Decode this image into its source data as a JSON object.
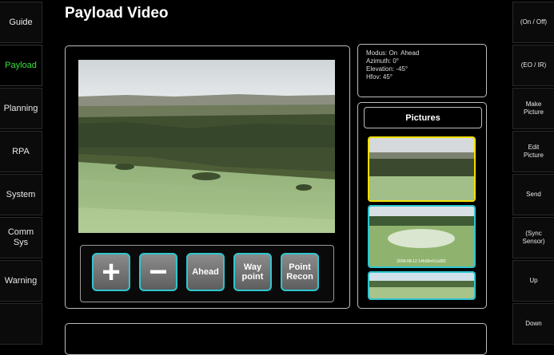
{
  "page": {
    "title": "Payload Video"
  },
  "left_nav": [
    {
      "label": "Guide",
      "active": false
    },
    {
      "label": "Payload",
      "active": true
    },
    {
      "label": "Planning",
      "active": false
    },
    {
      "label": "RPA",
      "active": false
    },
    {
      "label": "System",
      "active": false
    },
    {
      "label": "Comm Sys",
      "active": false
    },
    {
      "label": "Warning",
      "active": false
    }
  ],
  "right_nav": [
    {
      "label": "(On / Off)"
    },
    {
      "label": "(EO / IR)"
    },
    {
      "label": "Make Picture"
    },
    {
      "label": "Edit Picture"
    },
    {
      "label": "Send"
    },
    {
      "label": "(Sync Sensor)"
    },
    {
      "label": "Up"
    },
    {
      "label": "Down"
    }
  ],
  "status": {
    "modus": "Modus: On  Ahead",
    "azimuth": "Azimuth: 0°",
    "elevation": "Elevation: -45°",
    "hfov": "Hfov: 45°"
  },
  "controls": {
    "zoom_in": "+",
    "zoom_out": "−",
    "ahead": "Ahead",
    "waypoint": "Way point",
    "point_recon": "Point Recon"
  },
  "pictures": {
    "header": "Pictures",
    "thumb_caption": "2009-08-12 14h08m51s082"
  },
  "colors": {
    "active_nav": "#39e13a",
    "button_border": "#2ec6cf",
    "selected_thumb": "#f0e000"
  }
}
